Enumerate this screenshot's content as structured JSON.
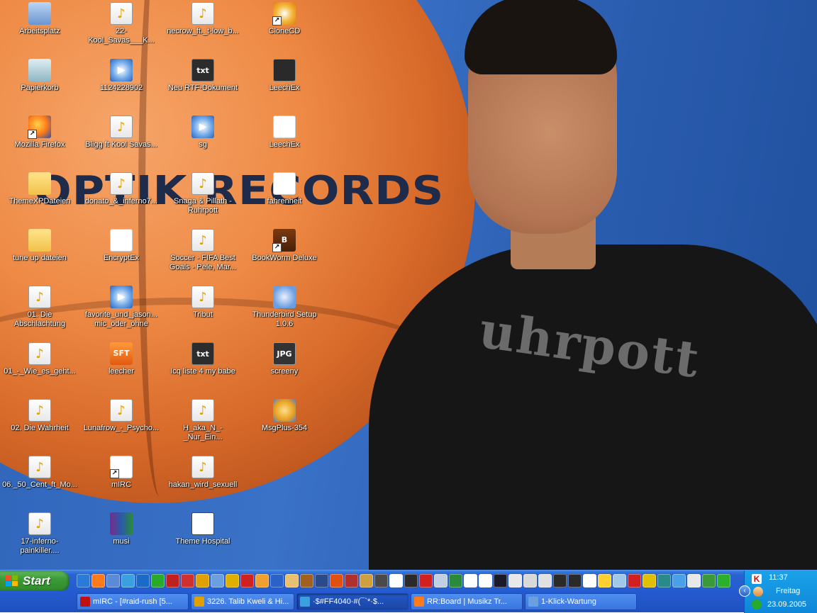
{
  "desktop": {
    "wallpaper_logo": "OPTIK RECORDS",
    "wallpaper_shirt_text": "uhrpott",
    "icons": [
      {
        "label": "Arbeitsplatz",
        "icon": "computer-icon"
      },
      {
        "label": "Papierkorb",
        "icon": "recycle-bin-icon"
      },
      {
        "label": "Mozilla Firefox",
        "icon": "firefox-icon"
      },
      {
        "label": "ThemeXPDateien",
        "icon": "folder-icon"
      },
      {
        "label": "tune up dateien",
        "icon": "folder-icon"
      },
      {
        "label": "01. Die Abschlachtung",
        "icon": "audio-file-icon"
      },
      {
        "label": "01_-_Wie_es_geht...",
        "icon": "audio-file-icon"
      },
      {
        "label": "02. Die Wahrheit",
        "icon": "audio-file-icon"
      },
      {
        "label": "06._50_Cent_ft_Mo...",
        "icon": "audio-file-icon"
      },
      {
        "label": "17-inferno-painkiller....",
        "icon": "audio-file-icon"
      },
      {
        "label": "22-Kool_Savas___K...",
        "icon": "audio-file-icon"
      },
      {
        "label": "1124228902",
        "icon": "media-file-icon"
      },
      {
        "label": "Bligg ft Kool Savas...",
        "icon": "audio-file-icon"
      },
      {
        "label": "donato_&_inferno7...",
        "icon": "audio-file-icon"
      },
      {
        "label": "EncryptEx",
        "icon": "cex-icon"
      },
      {
        "label": "favorite_und_jason... mic_oder_ohne",
        "icon": "media-file-icon"
      },
      {
        "label": "leecher",
        "icon": "sft-icon"
      },
      {
        "label": "Lunafrow_-_Psycho...",
        "icon": "audio-file-icon"
      },
      {
        "label": "mIRC",
        "icon": "mirc-icon"
      },
      {
        "label": "musi",
        "icon": "rar-archive-icon"
      },
      {
        "label": "necrow_ft._t-low_b...",
        "icon": "audio-file-icon"
      },
      {
        "label": "Neu RTF-Dokument",
        "icon": "text-file-icon"
      },
      {
        "label": "sg",
        "icon": "media-file-icon"
      },
      {
        "label": "Snaga & Pillath - Ruhrpott",
        "icon": "audio-file-icon"
      },
      {
        "label": "Soccer - FIFA Best Goals - Pele, Mar...",
        "icon": "audio-file-icon"
      },
      {
        "label": "Tribut",
        "icon": "audio-file-icon"
      },
      {
        "label": "Icq liste 4 my babe",
        "icon": "text-file-icon"
      },
      {
        "label": "H_aka_N_-_Nur_Ein...",
        "icon": "audio-file-icon"
      },
      {
        "label": "hakan_wird_sexuell",
        "icon": "audio-file-icon"
      },
      {
        "label": "Theme Hospital",
        "icon": "theme-hospital-icon"
      },
      {
        "label": "CloneCD",
        "icon": "clonecd-icon"
      },
      {
        "label": "LeechEx",
        "icon": "leechex-icon"
      },
      {
        "label": "LeechEx",
        "icon": "lex-icon"
      },
      {
        "label": "fahrenheit",
        "icon": "lex-file-icon"
      },
      {
        "label": "BookWorm Deluxe",
        "icon": "bookworm-icon"
      },
      {
        "label": "Thunderbird Setup 1.0.6",
        "icon": "thunderbird-setup-icon"
      },
      {
        "label": "screeny",
        "icon": "jpg-file-icon"
      },
      {
        "label": "MsgPlus-354",
        "icon": "msgplus-icon"
      }
    ]
  },
  "taskbar": {
    "start_label": "Start",
    "quick_launch_count": 44,
    "tasks": [
      {
        "label": "mIRC - [#raid-rush [5...",
        "active": false,
        "color": "#c01010"
      },
      {
        "label": "3226. Talib Kweli & Hi...",
        "active": false,
        "color": "#e0a000"
      },
      {
        "label": "·$#FF4040·#(¯`*·$...",
        "active": true,
        "color": "#3aa0e0"
      },
      {
        "label": "RR:Board | Musikz Tr...",
        "active": false,
        "color": "#ff7a1a"
      },
      {
        "label": "1-Klick-Wartung",
        "active": false,
        "color": "#6aa0e0"
      }
    ]
  },
  "tray": {
    "time": "11:37",
    "day": "Freitag",
    "date": "23.09.2005"
  },
  "colors": {
    "taskbar": "#245bd0",
    "start_button": "#3c9a38",
    "tray": "#0f86d8"
  }
}
